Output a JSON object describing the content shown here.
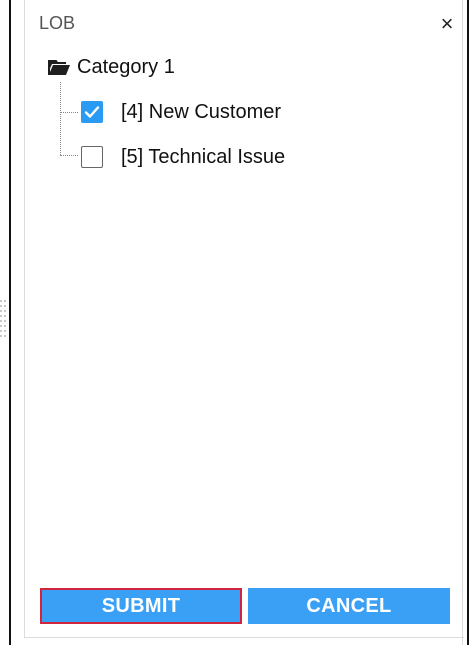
{
  "dialog": {
    "title": "LOB",
    "close_label": "×"
  },
  "tree": {
    "root": {
      "label": "Category 1",
      "icon": "folder-open-icon"
    },
    "children": [
      {
        "label": "[4] New Customer",
        "checked": true
      },
      {
        "label": "[5] Technical Issue",
        "checked": false
      }
    ]
  },
  "actions": {
    "submit_label": "SUBMIT",
    "cancel_label": "CANCEL"
  },
  "colors": {
    "button_blue": "#3aa0f5",
    "checkbox_blue": "#2b9af3",
    "focus_outline_red": "#d0253a"
  }
}
